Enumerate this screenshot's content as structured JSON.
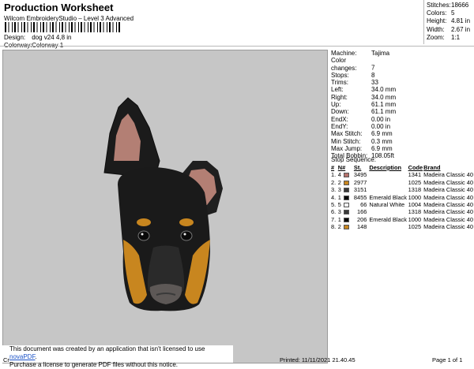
{
  "header": {
    "title": "Production Worksheet",
    "subtitle": "Wilcom EmbroideryStudio – Level 3 Advanced",
    "design_label": "Design:",
    "design_value": "dog v24 4,8 in",
    "colorway_label": "Colorway:",
    "colorway_value": "Colorway 1"
  },
  "stats": [
    {
      "label": "Stitches:",
      "value": "18666"
    },
    {
      "label": "Colors:",
      "value": "5"
    },
    {
      "label": "Height:",
      "value": "4.81 in"
    },
    {
      "label": "Width:",
      "value": "2.67 in"
    },
    {
      "label": "Zoom:",
      "value": "1:1"
    }
  ],
  "machine_info": [
    {
      "label": "Machine:",
      "value": "Tajima"
    },
    {
      "label": "Color changes:",
      "value": "7"
    },
    {
      "label": "Stops:",
      "value": "8"
    },
    {
      "label": "Trims:",
      "value": "33"
    },
    {
      "label": "Left:",
      "value": "34.0 mm"
    },
    {
      "label": "Right:",
      "value": "34.0 mm"
    },
    {
      "label": "Up:",
      "value": "61.1 mm"
    },
    {
      "label": "Down:",
      "value": "61.1 mm"
    },
    {
      "label": "EndX:",
      "value": "0.00 in"
    },
    {
      "label": "EndY:",
      "value": "0.00 in"
    },
    {
      "label": "Max Stitch:",
      "value": "6.9 mm"
    },
    {
      "label": "Min Stitch:",
      "value": "0.3 mm"
    },
    {
      "label": "Max Jump:",
      "value": "6.9 mm"
    },
    {
      "label": "Total Bobbin:",
      "value": "108.05ft"
    }
  ],
  "stop_sequence": {
    "title": "Stop Sequence:",
    "headers": [
      "#",
      "N#",
      "St.",
      "Description",
      "Code",
      "Brand"
    ],
    "rows": [
      {
        "num": "1.",
        "n": "4",
        "color": "#b5726c",
        "st": "3495",
        "desc": "",
        "code": "1341",
        "brand": "Madeira Classic 40"
      },
      {
        "num": "2.",
        "n": "2",
        "color": "#c8861f",
        "st": "2977",
        "desc": "",
        "code": "1025",
        "brand": "Madeira Classic 40"
      },
      {
        "num": "3.",
        "n": "3",
        "color": "#3a3a3a",
        "st": "3151",
        "desc": "",
        "code": "1318",
        "brand": "Madeira Classic 40"
      },
      {
        "num": "4.",
        "n": "1",
        "color": "#0a0a0a",
        "st": "8455",
        "desc": "Emerald Black",
        "code": "1000",
        "brand": "Madeira Classic 40"
      },
      {
        "num": "5.",
        "n": "5",
        "color": "#f2f2f2",
        "st": "66",
        "desc": "Natural White",
        "code": "1004",
        "brand": "Madeira Classic 40"
      },
      {
        "num": "6.",
        "n": "3",
        "color": "#3a3a3a",
        "st": "166",
        "desc": "",
        "code": "1318",
        "brand": "Madeira Classic 40"
      },
      {
        "num": "7.",
        "n": "1",
        "color": "#0a0a0a",
        "st": "206",
        "desc": "Emerald Black",
        "code": "1000",
        "brand": "Madeira Classic 40"
      },
      {
        "num": "8.",
        "n": "2",
        "color": "#c8861f",
        "st": "148",
        "desc": "",
        "code": "1025",
        "brand": "Madeira Classic 40"
      }
    ]
  },
  "notice": {
    "line1_prefix": "This document was created by an application that isn't licensed to use ",
    "link": "novaPDF",
    "line1_suffix": ".",
    "line2": "Purchase a license to generate PDF files without this notice."
  },
  "footer": {
    "left": "Cr",
    "printed": "Printed: 11/11/2021 21.40.45",
    "page": "Page 1 of 1"
  }
}
